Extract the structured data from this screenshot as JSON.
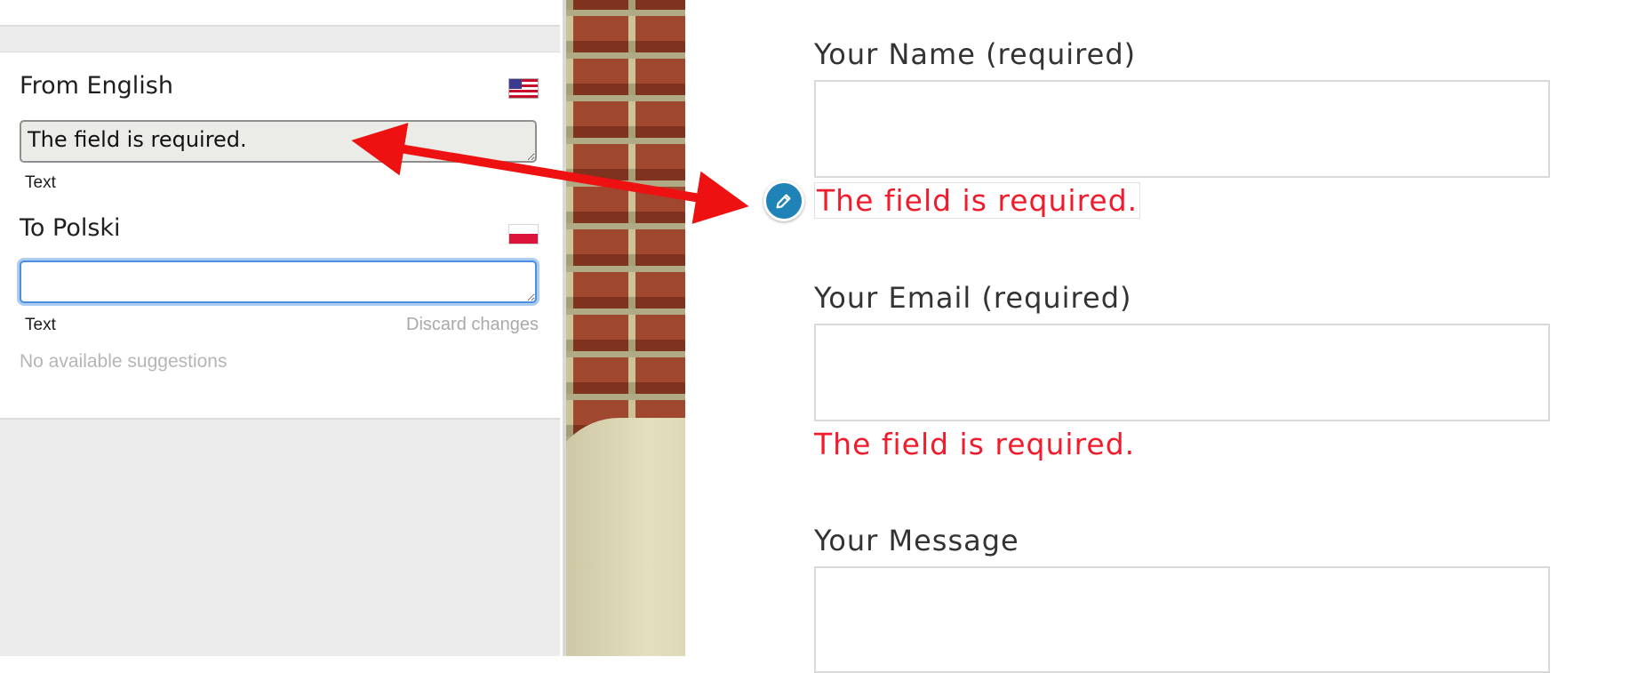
{
  "panel": {
    "source": {
      "heading": "From English",
      "flag": "us-flag-icon",
      "text": "The field is required.",
      "type_label": "Text"
    },
    "target": {
      "heading": "To Polski",
      "flag": "pl-flag-icon",
      "text": "",
      "type_label": "Text",
      "discard_label": "Discard changes"
    },
    "suggestions_empty": "No available suggestions"
  },
  "form": {
    "fields": [
      {
        "label": "Your Name (required)",
        "error": "The field is required."
      },
      {
        "label": "Your Email (required)",
        "error": "The field is required."
      },
      {
        "label": "Your Message"
      }
    ],
    "edit_icon": "pencil-icon"
  },
  "colors": {
    "error": "#f01c2c",
    "annotation_arrow": "#ee1111",
    "edit_button": "#1f83b8",
    "focus_ring": "#4a8fe0"
  }
}
